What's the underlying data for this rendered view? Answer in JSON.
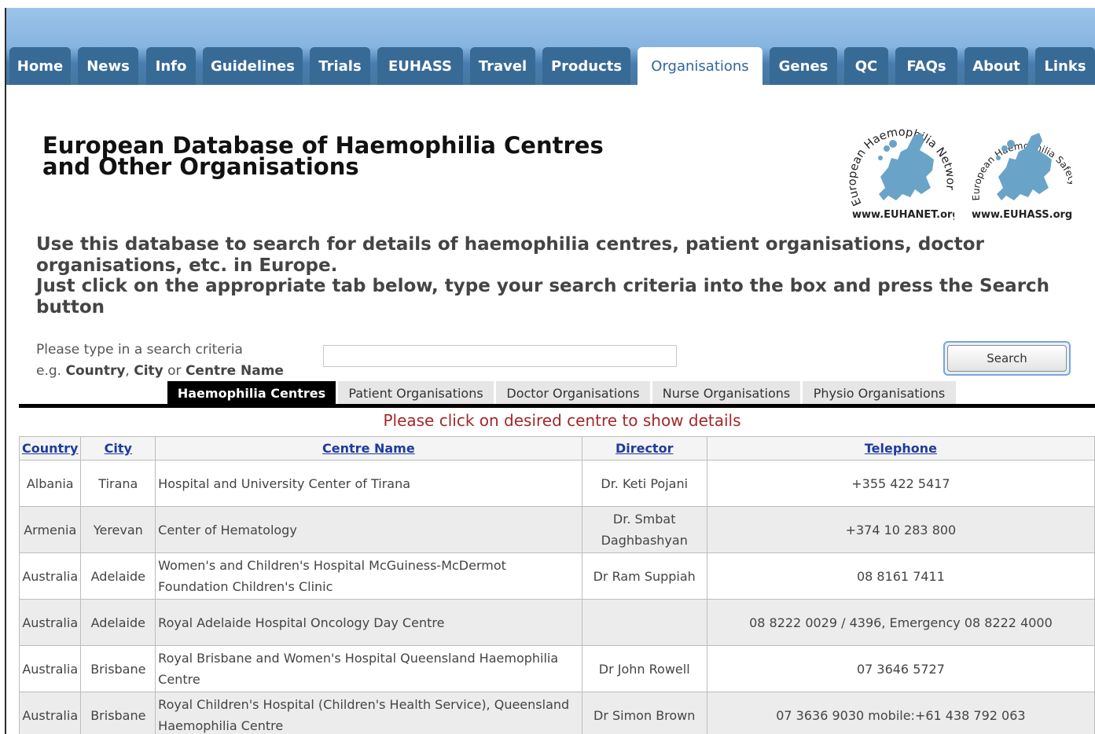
{
  "nav": {
    "tabs": [
      {
        "label": "Home"
      },
      {
        "label": "News"
      },
      {
        "label": "Info"
      },
      {
        "label": "Guidelines"
      },
      {
        "label": "Trials"
      },
      {
        "label": "EUHASS"
      },
      {
        "label": "Travel"
      },
      {
        "label": "Products"
      },
      {
        "label": "Organisations"
      },
      {
        "label": "Genes"
      },
      {
        "label": "QC"
      },
      {
        "label": "FAQs"
      },
      {
        "label": "About"
      },
      {
        "label": "Links"
      }
    ],
    "active": "Organisations"
  },
  "header": {
    "title_line1": "European Database of Haemophilia Centres",
    "title_line2": "and Other Organisations"
  },
  "logos": {
    "euhanet": {
      "arc_text": "European Haemophilia Network",
      "url": "www.EUHANET.org"
    },
    "euhass": {
      "arc_text": "European Haemophilia Safety Surveillance",
      "url": "www.EUHASS.org"
    }
  },
  "intro": {
    "line1": "Use this database to search for details of haemophilia centres, patient organisations, doctor organisations, etc. in Europe.",
    "line2": "Just click on the appropriate tab below, type your search criteria into the box and press the Search button"
  },
  "search": {
    "prompt": "Please type in a search criteria",
    "example_prefix": "e.g.",
    "example_country": "Country",
    "example_sep1": ",",
    "example_city": "City",
    "example_or": "or",
    "example_centre": "Centre Name",
    "input_value": "",
    "placeholder": "",
    "button_label": "Search"
  },
  "category_tabs": [
    {
      "label": "Haemophilia Centres"
    },
    {
      "label": "Patient Organisations"
    },
    {
      "label": "Doctor Organisations"
    },
    {
      "label": "Nurse Organisations"
    },
    {
      "label": "Physio Organisations"
    }
  ],
  "hint": "Please click on desired centre to show details",
  "table": {
    "headers": [
      "Country",
      "City",
      "Centre Name",
      "Director",
      "Telephone"
    ],
    "rows": [
      [
        "Albania",
        "Tirana",
        "Hospital and University Center of Tirana",
        "Dr. Keti Pojani",
        "+355 422 5417"
      ],
      [
        "Armenia",
        "Yerevan",
        "Center of Hematology",
        "Dr. Smbat Daghbashyan",
        "+374 10 283 800"
      ],
      [
        "Australia",
        "Adelaide",
        "Women's and Children's Hospital McGuiness-McDermot Foundation Children's Clinic",
        "Dr Ram Suppiah",
        "08 8161 7411"
      ],
      [
        "Australia",
        "Adelaide",
        "Royal Adelaide Hospital Oncology Day Centre",
        "",
        "08 8222 0029 / 4396, Emergency 08 8222 4000"
      ],
      [
        "Australia",
        "Brisbane",
        "Royal Brisbane and Women's Hospital Queensland Haemophilia Centre",
        "Dr John Rowell",
        "07 3646 5727"
      ],
      [
        "Australia",
        "Brisbane",
        "Royal Children's Hospital (Children's Health Service), Queensland Haemophilia Centre",
        "Dr Simon Brown",
        "07 3636 9030 mobile:+61 438 792 063"
      ]
    ]
  },
  "colors": {
    "tab_bg": "#386a96",
    "tab_active_text": "#336699",
    "hint": "#a3272a",
    "header_link": "#1f3b9e",
    "logo_map": "#6aa3c8"
  }
}
